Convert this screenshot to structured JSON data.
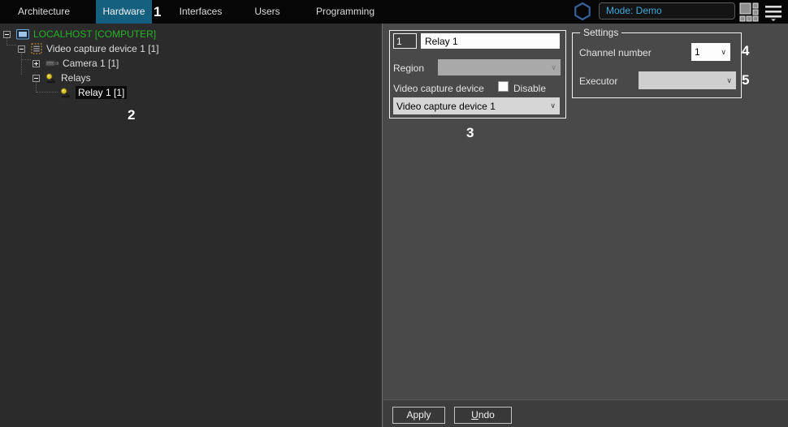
{
  "topbar": {
    "tabs": [
      {
        "label": "Architecture",
        "active": false
      },
      {
        "label": "Hardware",
        "active": true
      },
      {
        "label": "Interfaces",
        "active": false
      },
      {
        "label": "Users",
        "active": false
      },
      {
        "label": "Programming",
        "active": false
      }
    ],
    "mode_field_value": "Mode: Demo"
  },
  "annotations": {
    "n1": "1",
    "n2": "2",
    "n3": "3",
    "n4": "4",
    "n5": "5"
  },
  "tree": {
    "items": [
      {
        "label": "LOCALHOST [COMPUTER]",
        "icon": "computer-icon",
        "expander": "minus",
        "selected": false
      },
      {
        "label": "Video capture device 1 [1]",
        "icon": "capture-board-icon",
        "expander": "minus",
        "selected": false
      },
      {
        "label": "Camera 1 [1]",
        "icon": "camera-icon",
        "expander": "plus",
        "selected": false
      },
      {
        "label": "Relays",
        "icon": "relay-icon",
        "expander": "minus",
        "selected": false
      },
      {
        "label": "Relay 1 [1]",
        "icon": "relay-icon",
        "expander": "none",
        "selected": true
      }
    ]
  },
  "properties_panel": {
    "id_value": "1",
    "name_value": "Relay 1",
    "region_label": "Region",
    "region_value": "",
    "video_capture_device_label": "Video capture device",
    "disable_label": "Disable",
    "disable_checked": false,
    "video_capture_device_value": "Video capture device 1"
  },
  "settings_group": {
    "title": "Settings",
    "channel_number_label": "Channel number",
    "channel_number_value": "1",
    "executor_label": "Executor",
    "executor_value": ""
  },
  "buttons": {
    "apply": "Apply",
    "undo": "Undo"
  },
  "colors": {
    "active_tab": "#15607f",
    "tree_computer_text": "#25b325",
    "mode_text": "#3fa9dc",
    "panel_background": "#494949",
    "tree_background": "#2b2b2b",
    "topbar_background": "#060606"
  }
}
